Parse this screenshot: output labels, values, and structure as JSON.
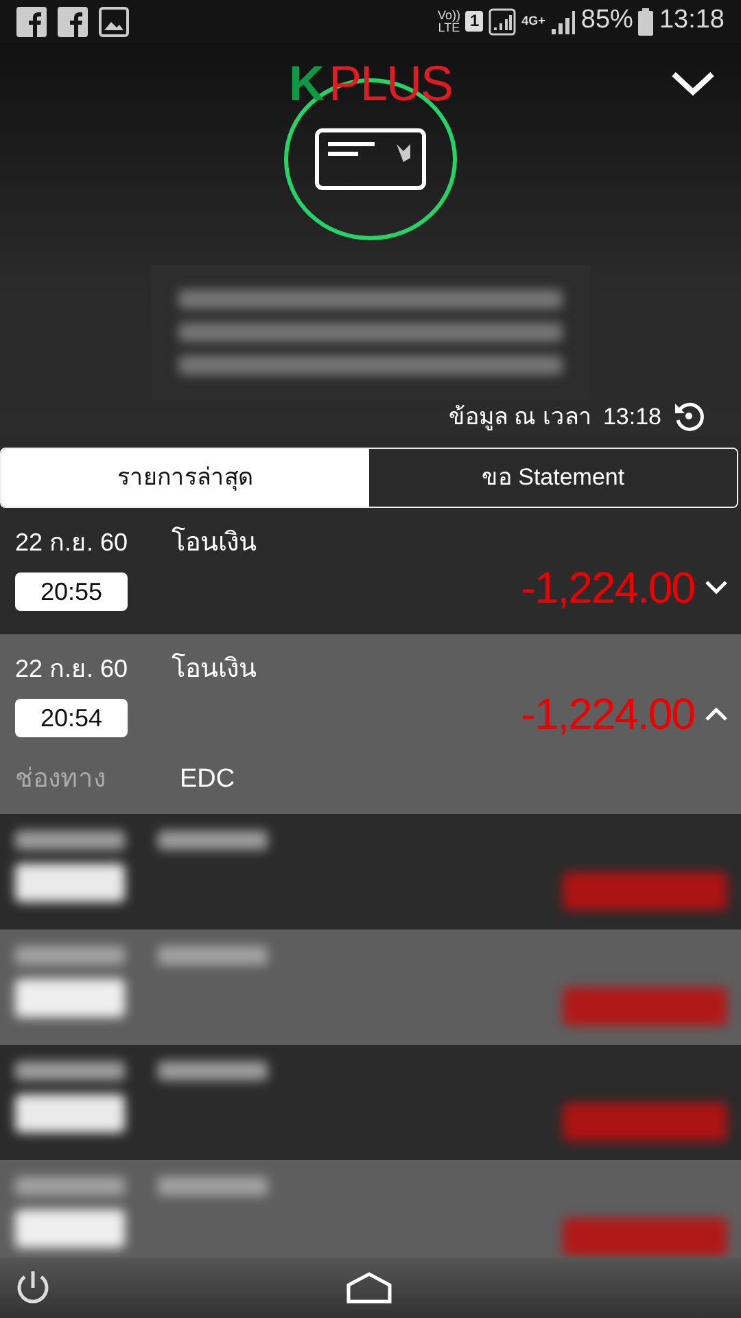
{
  "status_bar": {
    "battery": "85%",
    "time": "13:18",
    "network": "4G+",
    "volte": "Vo))\nLTE",
    "sim": "1"
  },
  "header": {
    "logo_k": "K",
    "logo_plus": "PLUS"
  },
  "updated": {
    "label": "ข้อมูล ณ เวลา",
    "time": "13:18"
  },
  "tabs": [
    {
      "label": "รายการล่าสุด",
      "selected": true
    },
    {
      "label": "ขอ Statement",
      "selected": false
    }
  ],
  "transactions": [
    {
      "kind": "entry",
      "date": "22 ก.ย. 60",
      "time": "20:55",
      "title": "โอนเงิน",
      "amount": "-1,224.00",
      "expanded": false
    },
    {
      "kind": "entry",
      "date": "22 ก.ย. 60",
      "time": "20:54",
      "title": "โอนเงิน",
      "amount": "-1,224.00",
      "expanded": true,
      "detail_label": "ช่องทาง",
      "detail_value": "EDC"
    },
    {
      "kind": "blurred"
    },
    {
      "kind": "blurred"
    },
    {
      "kind": "blurred"
    },
    {
      "kind": "blurred"
    }
  ]
}
